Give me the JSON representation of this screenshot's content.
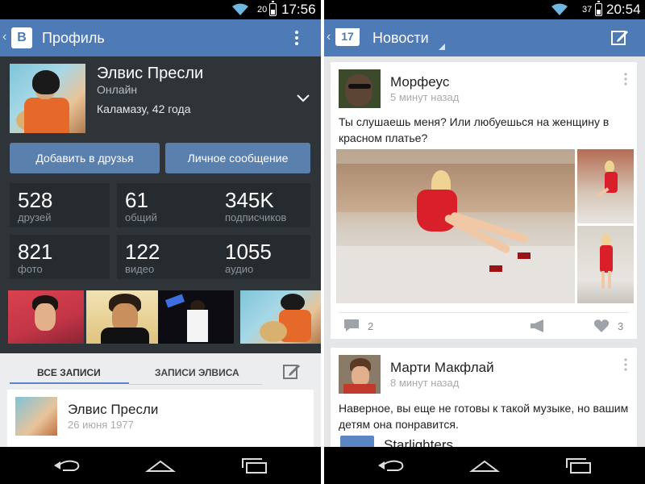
{
  "left_screen": {
    "status_bar": {
      "battery_percent": "20",
      "time": "17:56"
    },
    "action_bar": {
      "title": "Профиль"
    },
    "profile": {
      "name": "Элвис Пресли",
      "status": "Онлайн",
      "location": "Каламазу, 42 года"
    },
    "buttons": {
      "add_friend": "Добавить в друзья",
      "message": "Личное сообщение"
    },
    "stats": [
      {
        "value": "528",
        "label": "друзей"
      },
      {
        "value": "61",
        "label": "общий"
      },
      {
        "value": "345K",
        "label": "подписчиков"
      },
      {
        "value": "821",
        "label": "фото"
      },
      {
        "value": "122",
        "label": "видео"
      },
      {
        "value": "1055",
        "label": "аудио"
      }
    ],
    "tabs": [
      {
        "label": "ВСЕ ЗАПИСИ",
        "active": true
      },
      {
        "label": "ЗАПИСИ ЭЛВИСА",
        "active": false
      }
    ],
    "post": {
      "author": "Элвис Пресли",
      "date": "26 июня 1977"
    }
  },
  "right_screen": {
    "status_bar": {
      "battery_percent": "37",
      "time": "20:54"
    },
    "action_bar": {
      "title": "Новости",
      "badge": "17"
    },
    "posts": [
      {
        "author": "Морфеус",
        "time": "5 минут назад",
        "text": "Ты слушаешь меня? Или любуешься на женщину в красном платье?",
        "comments": "2",
        "likes": "3"
      },
      {
        "author": "Марти Макфлай",
        "time": "8 минут назад",
        "text": "Наверное, вы еще не готовы к такой музыке, но вашим детям она понравится.",
        "attachment": "Starlighters"
      }
    ]
  },
  "colors": {
    "action_bar": "#4e7bb6",
    "profile_bg": "#2e3438",
    "stat_box": "#252b2f",
    "button": "#5a80ad",
    "feed_bg": "#e4e6e8"
  }
}
